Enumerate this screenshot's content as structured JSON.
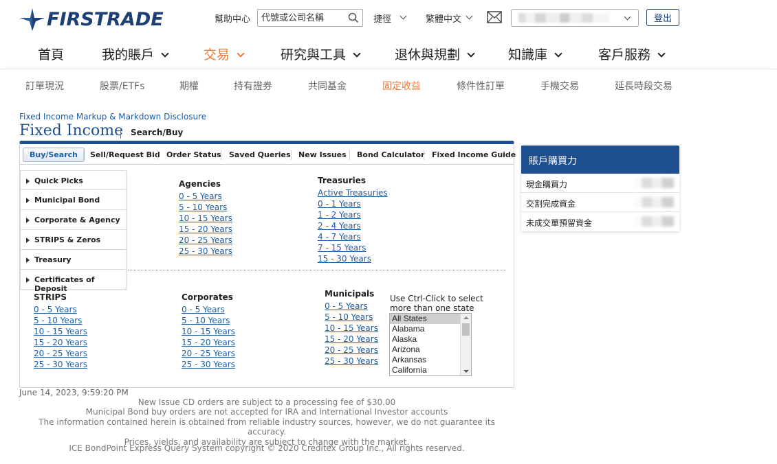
{
  "header": {
    "brand": "FIRSTRADE",
    "help": "幫助中心",
    "search_placeholder": "代號或公司名稱",
    "shortcuts": "捷徑",
    "language": "繁體中文",
    "logout": "登出"
  },
  "main_nav": [
    {
      "label": "首頁"
    },
    {
      "label": "我的賬戶"
    },
    {
      "label": "交易"
    },
    {
      "label": "研究與工具"
    },
    {
      "label": "退休與規劃"
    },
    {
      "label": "知識庫"
    },
    {
      "label": "客戶服務"
    }
  ],
  "sub_nav": [
    {
      "label": "訂單現況"
    },
    {
      "label": "股票/ETFs"
    },
    {
      "label": "期權"
    },
    {
      "label": "持有證券"
    },
    {
      "label": "共同基金"
    },
    {
      "label": "固定收益"
    },
    {
      "label": "條件性訂單"
    },
    {
      "label": "手機交易"
    },
    {
      "label": "延長時段交易"
    }
  ],
  "page": {
    "disclosure_link": "Fixed Income Markup & Markdown Disclosure",
    "title": "Fixed Income",
    "subtitle": "Search/Buy"
  },
  "tabs": [
    {
      "label": "Buy/Search"
    },
    {
      "label": "Sell/Request Bid"
    },
    {
      "label": "Order Status"
    },
    {
      "label": "Saved Queries"
    },
    {
      "label": "New Issues"
    },
    {
      "label": "Bond Calculator"
    },
    {
      "label": "Fixed Income Guide"
    }
  ],
  "side_menu": [
    {
      "label": "Quick Picks"
    },
    {
      "label": "Municipal Bond"
    },
    {
      "label": "Corporate & Agency"
    },
    {
      "label": "STRIPS & Zeros"
    },
    {
      "label": "Treasury"
    },
    {
      "label": "Certificates of Deposit"
    }
  ],
  "agencies": {
    "heading": "Agencies",
    "links": [
      "0 - 5 Years",
      "5 - 10 Years",
      "10 - 15 Years",
      "15 - 20 Years",
      "20 - 25 Years",
      "25 - 30 Years"
    ]
  },
  "treasuries": {
    "heading": "Treasuries",
    "links": [
      "Active Treasuries",
      "0 - 1 Years",
      "1 - 2 Years",
      "2 - 4 Years",
      "4 - 7 Years",
      "7 - 15 Years",
      "15 - 30 Years"
    ]
  },
  "strips": {
    "heading": "STRIPS",
    "links": [
      "0 - 5 Years",
      "5 - 10 Years",
      "10 - 15 Years",
      "15 - 20 Years",
      "20 - 25 Years",
      "25 - 30 Years"
    ]
  },
  "corporates": {
    "heading": "Corporates",
    "links": [
      "0 - 5 Years",
      "5 - 10 Years",
      "10 - 15 Years",
      "15 - 20 Years",
      "20 - 25 Years",
      "25 - 30 Years"
    ]
  },
  "municipals": {
    "heading": "Municipals",
    "links": [
      "0 - 5 Years",
      "5 - 10 Years",
      "10 - 15 Years",
      "15 - 20 Years",
      "20 - 25 Years",
      "25 - 30 Years"
    ],
    "state_hint": "Use Ctrl-Click to select more than one state",
    "states": [
      "All States",
      "Alabama",
      "Alaska",
      "Arizona",
      "Arkansas",
      "California"
    ]
  },
  "buying_power": {
    "title": "賬戶購買力",
    "rows": [
      {
        "label": "現金購買力"
      },
      {
        "label": "交割完成資金"
      },
      {
        "label": "未成交單預留資金"
      }
    ]
  },
  "footer": {
    "timestamp": "June 14, 2023, 9:59:20 PM",
    "notes": [
      "New Issue CD orders are subject to a processing fee of $30.00",
      "Municipal Bond buy orders are not accepted for IRA and International Investor accounts",
      "The information contained herein is obtained from reliable industry sources, however, we do not guarantee its accuracy.",
      "Prices, yields, and availability are subject to change with the market."
    ],
    "copyright": "ICE BondPoint Express Query System copyright © 2020 Creditex Group Inc., All rights reserved."
  },
  "colors": {
    "brand_navy": "#1e3f73",
    "accent_orange": "#e87a3a",
    "link_blue": "#1a5ea8"
  }
}
